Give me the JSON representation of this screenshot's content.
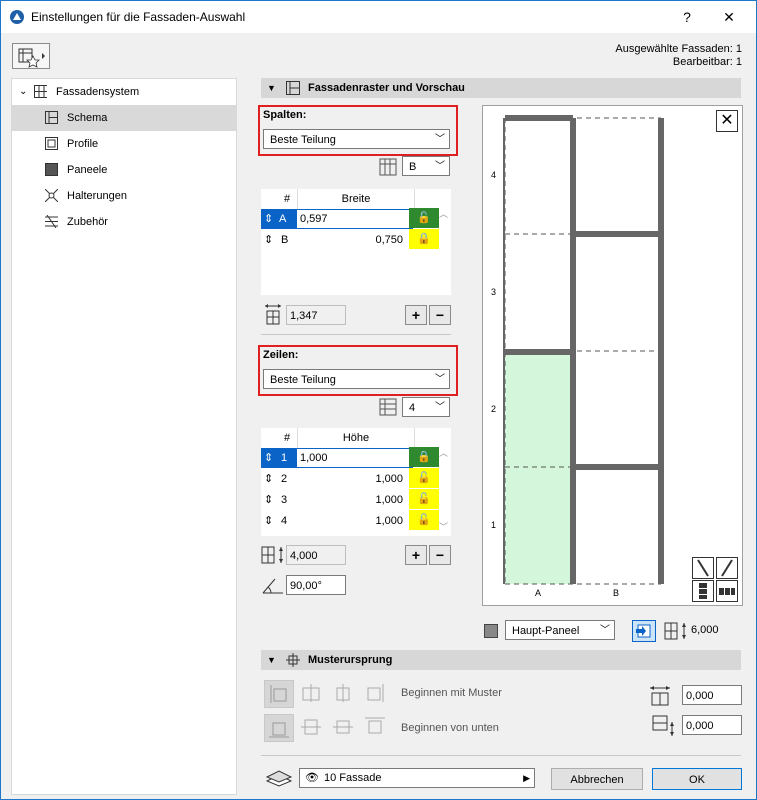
{
  "window": {
    "title": "Einstellungen für die Fassaden-Auswahl",
    "help_label": "?",
    "close_label": "✕"
  },
  "header": {
    "selected": "Ausgewählte Fassaden: 1",
    "editable": "Bearbeitbar: 1"
  },
  "sidebar": {
    "items": [
      {
        "label": "Fassadensystem"
      },
      {
        "label": "Schema"
      },
      {
        "label": "Profile"
      },
      {
        "label": "Paneele"
      },
      {
        "label": "Halterungen"
      },
      {
        "label": "Zubehör"
      }
    ]
  },
  "grid_section": {
    "title": "Fassadenraster und Vorschau",
    "columns": {
      "label": "Spalten:",
      "mode": "Beste Teilung",
      "pattern_select": "B",
      "col_num": "#",
      "col_width": "Breite",
      "rows": [
        {
          "id": "A",
          "value": "0,597"
        },
        {
          "id": "B",
          "value": "0,750"
        }
      ],
      "total": "1,347"
    },
    "rows": {
      "label": "Zeilen:",
      "mode": "Beste Teilung",
      "count_select": "4",
      "col_num": "#",
      "col_height": "Höhe",
      "rows": [
        {
          "id": "1",
          "value": "1,000"
        },
        {
          "id": "2",
          "value": "1,000"
        },
        {
          "id": "3",
          "value": "1,000"
        },
        {
          "id": "4",
          "value": "1,000"
        }
      ],
      "total": "4,000",
      "angle": "90,00°"
    },
    "preview": {
      "row_labels": [
        "4",
        "3",
        "2",
        "1"
      ],
      "col_labels": [
        "A",
        "B"
      ]
    },
    "panel_select": "Haupt-Paneel",
    "panel_value": "6,000"
  },
  "pattern_section": {
    "title": "Musterursprung",
    "start_with_pattern": "Beginnen mit Muster",
    "start_from_bottom": "Beginnen von unten",
    "offset_x": "0,000",
    "offset_y": "0,000"
  },
  "footer": {
    "layer": "10 Fassade",
    "cancel": "Abbrechen",
    "ok": "OK"
  }
}
